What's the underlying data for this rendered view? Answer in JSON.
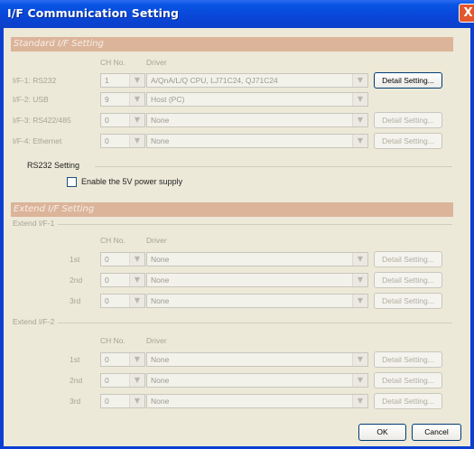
{
  "window": {
    "title": "I/F Communication Setting",
    "close_glyph": "X"
  },
  "standard": {
    "header": "Standard I/F Setting",
    "col_ch": "CH No.",
    "col_driver": "Driver",
    "rows": [
      {
        "label": "I/F-1: RS232",
        "ch": "1",
        "driver": "A/QnA/L/Q CPU, LJ71C24, QJ71C24",
        "button": "Detail Setting...",
        "button_enabled": true
      },
      {
        "label": "I/F-2: USB",
        "ch": "9",
        "driver": "Host (PC)",
        "button": null,
        "button_enabled": false
      },
      {
        "label": "I/F-3: RS422/485",
        "ch": "0",
        "driver": "None",
        "button": "Detail Setting...",
        "button_enabled": false
      },
      {
        "label": "I/F-4: Ethernet",
        "ch": "0",
        "driver": "None",
        "button": "Detail Setting...",
        "button_enabled": false
      }
    ],
    "rs232": {
      "label": "RS232 Setting",
      "checkbox_label": "Enable the 5V power supply",
      "checked": false
    }
  },
  "extend": {
    "header": "Extend I/F Setting",
    "groups": [
      {
        "label": "Extend I/F-1",
        "col_ch": "CH No.",
        "col_driver": "Driver",
        "rows": [
          {
            "label": "1st",
            "ch": "0",
            "driver": "None",
            "button": "Detail Setting..."
          },
          {
            "label": "2nd",
            "ch": "0",
            "driver": "None",
            "button": "Detail Setting..."
          },
          {
            "label": "3rd",
            "ch": "0",
            "driver": "None",
            "button": "Detail Setting..."
          }
        ]
      },
      {
        "label": "Extend I/F-2",
        "col_ch": "CH No.",
        "col_driver": "Driver",
        "rows": [
          {
            "label": "1st",
            "ch": "0",
            "driver": "None",
            "button": "Detail Setting..."
          },
          {
            "label": "2nd",
            "ch": "0",
            "driver": "None",
            "button": "Detail Setting..."
          },
          {
            "label": "3rd",
            "ch": "0",
            "driver": "None",
            "button": "Detail Setting..."
          }
        ]
      }
    ]
  },
  "footer": {
    "ok": "OK",
    "cancel": "Cancel"
  },
  "colors": {
    "titlebar": "#0a46d8",
    "section_header": "#dcb49a",
    "client": "#ece9d8"
  },
  "icons": {
    "dropdown": "chevron-down-icon",
    "close": "close-icon"
  }
}
